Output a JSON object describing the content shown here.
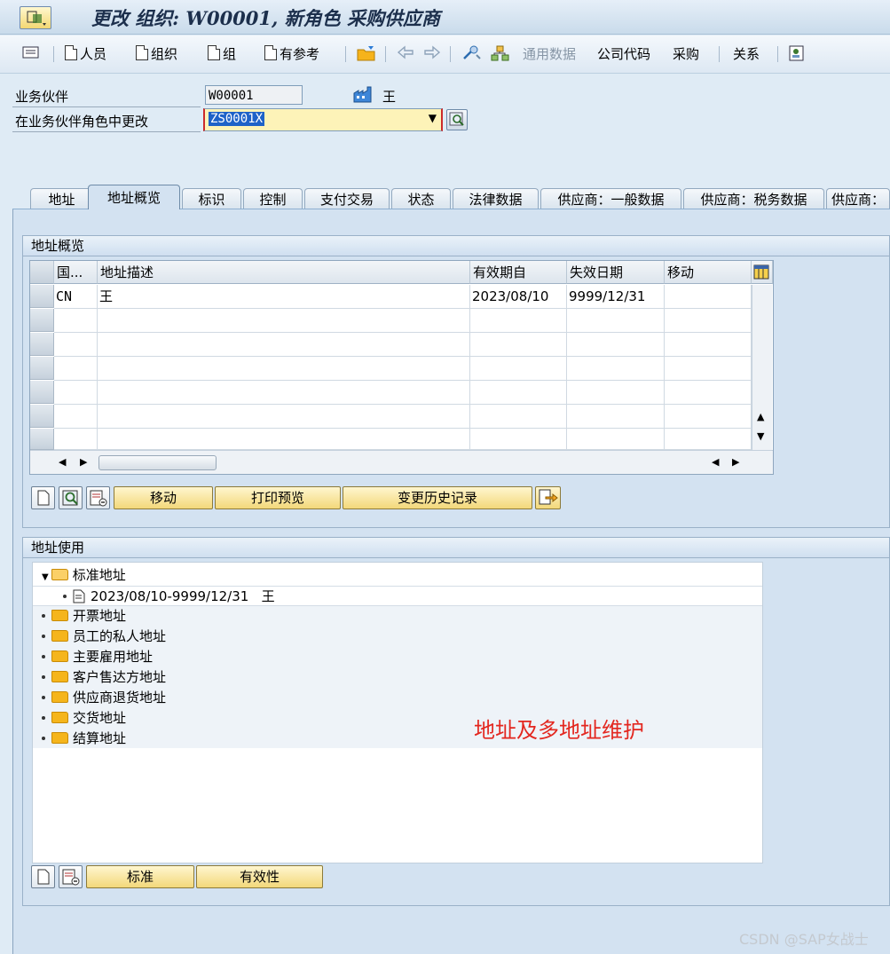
{
  "window": {
    "title": "更改 组织: W00001, 新角色 采购供应商"
  },
  "toolbar": {
    "person": "人员",
    "org": "组织",
    "group": "组",
    "with_ref": "有参考",
    "general_data": "通用数据",
    "company_code": "公司代码",
    "purchasing": "采购",
    "relationships": "关系"
  },
  "header": {
    "bp_label": "业务伙伴",
    "bp_value": "W00001",
    "bp_name": "王",
    "role_label": "在业务伙伴角色中更改",
    "role_value": "ZS0001X"
  },
  "tabs": [
    "地址",
    "地址概览",
    "标识",
    "控制",
    "支付交易",
    "状态",
    "法律数据",
    "供应商：一般数据",
    "供应商：税务数据",
    "供应商："
  ],
  "address_overview": {
    "title": "地址概览",
    "columns": [
      "国...",
      "地址描述",
      "有效期自",
      "失效日期",
      "移动"
    ],
    "rows": [
      {
        "country": "CN",
        "desc": "王",
        "valid_from": "2023/08/10",
        "valid_to": "9999/12/31",
        "move": ""
      }
    ],
    "buttons": {
      "move": "移动",
      "print_preview": "打印预览",
      "change_history": "变更历史记录"
    }
  },
  "address_usage": {
    "title": "地址使用",
    "root": "标准地址",
    "root_child": "2023/08/10-9999/12/31   王",
    "items": [
      "开票地址",
      "员工的私人地址",
      "主要雇用地址",
      "客户售达方地址",
      "供应商退货地址",
      "交货地址",
      "结算地址"
    ],
    "buttons": {
      "standard": "标准",
      "validity": "有效性"
    }
  },
  "annotation": "地址及多地址维护",
  "watermark": "CSDN @SAP女战士"
}
